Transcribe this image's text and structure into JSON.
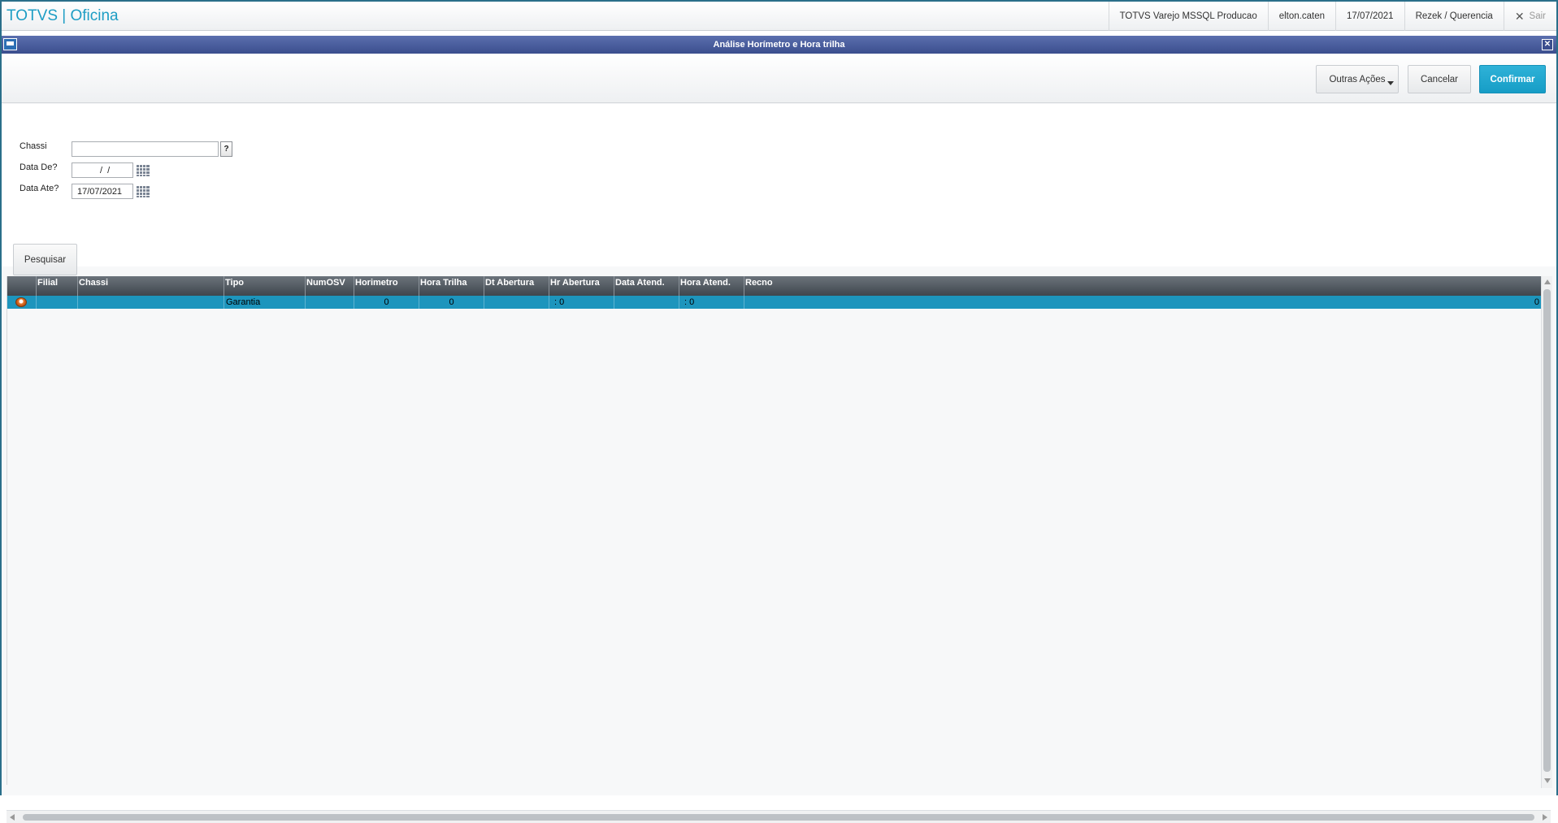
{
  "app": {
    "title": "TOTVS | Oficina"
  },
  "topbar": {
    "environment": "TOTVS Varejo MSSQL Producao",
    "user": "elton.caten",
    "date": "17/07/2021",
    "branch": "Rezek / Querencia",
    "logout": "Sair",
    "logout_icon": "close-x-icon"
  },
  "dialog": {
    "title": "Análise Horímetro e Hora trilha",
    "toolbar": {
      "outras_acoes": "Outras Ações",
      "cancelar": "Cancelar",
      "confirmar": "Confirmar"
    },
    "form": {
      "chassi_label": "Chassi",
      "chassi_value": "",
      "help_label": "?",
      "data_de_label": "Data De?",
      "data_de_value": "  /  /",
      "data_ate_label": "Data Ate?",
      "data_ate_value": "17/07/2021",
      "pesquisar": "Pesquisar"
    },
    "grid": {
      "columns": [
        "",
        "Filial",
        "Chassi",
        "Tipo",
        "NumOSV",
        "Horimetro",
        "Hora Trilha",
        "Dt Abertura",
        "Hr Abertura",
        "Data Atend.",
        "Hora Atend.",
        "Recno"
      ],
      "rows": [
        [
          "",
          "",
          "",
          "Garantia",
          "",
          "0",
          "0",
          "",
          " : 0",
          "",
          " : 0",
          "0"
        ]
      ],
      "selected_row_color": "#1d95bd"
    }
  }
}
